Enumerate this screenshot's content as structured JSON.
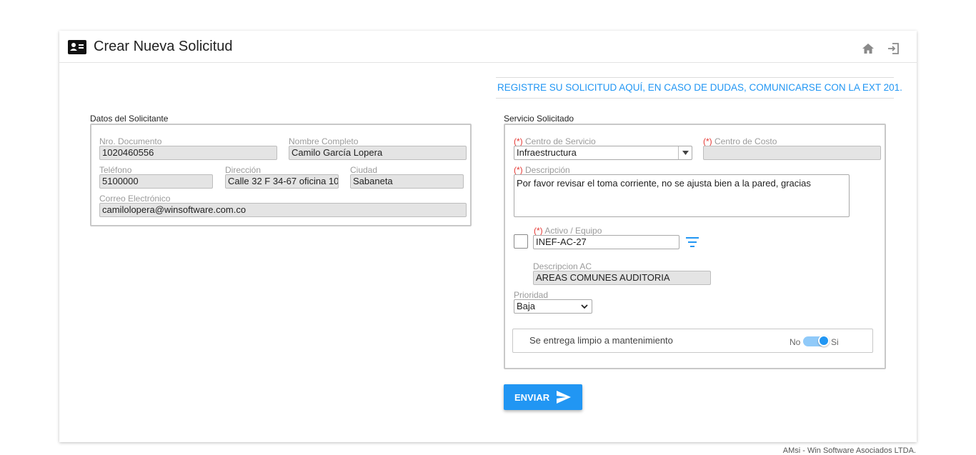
{
  "header": {
    "title": "Crear Nueva Solicitud"
  },
  "notice": "REGISTRE SU SOLICITUD AQUÍ, EN CASO DE DUDAS, COMUNICARSE CON LA EXT 201.",
  "solicitante": {
    "legend": "Datos del Solicitante",
    "documento_label": "Nro. Documento",
    "documento_value": "1020460556",
    "nombre_label": "Nombre Completo",
    "nombre_value": "Camilo García Lopera",
    "telefono_label": "Teléfono",
    "telefono_value": "5100000",
    "direccion_label": "Dirección",
    "direccion_value": "Calle 32 F 34-67 oficina 10",
    "ciudad_label": "Ciudad",
    "ciudad_value": "Sabaneta",
    "correo_label": "Correo Electrónico",
    "correo_value": "camilolopera@winsoftware.com.co"
  },
  "servicio": {
    "legend": "Servicio Solicitado",
    "required_mark": "(*)",
    "centro_servicio_label": "Centro de Servicio",
    "centro_servicio_value": "Infraestructura",
    "centro_costo_label": "Centro de Costo",
    "centro_costo_value": "",
    "descripcion_label": "Descripción",
    "descripcion_value": "Por favor revisar el toma corriente, no se ajusta bien a la pared, gracias",
    "activo_label": "Activo / Equipo",
    "activo_value": "INEF-AC-27",
    "descripcion_ac_label": "Descripcion AC",
    "descripcion_ac_value": "AREAS COMUNES AUDITORIA",
    "prioridad_label": "Prioridad",
    "prioridad_value": "Baja",
    "limpio_label": "Se entrega limpio a mantenimiento",
    "toggle_no": "No",
    "toggle_si": "Si",
    "toggle_state": "Si"
  },
  "actions": {
    "send_label": "ENVIAR"
  },
  "footer": "AMsi - Win Software Asociados LTDA.",
  "colors": {
    "accent": "#2196f3",
    "required": "#e53935"
  },
  "icons": {
    "header": "id-card-icon",
    "home": "home-icon",
    "exit": "exit-icon",
    "filter": "filter-icon",
    "send": "send-icon"
  }
}
